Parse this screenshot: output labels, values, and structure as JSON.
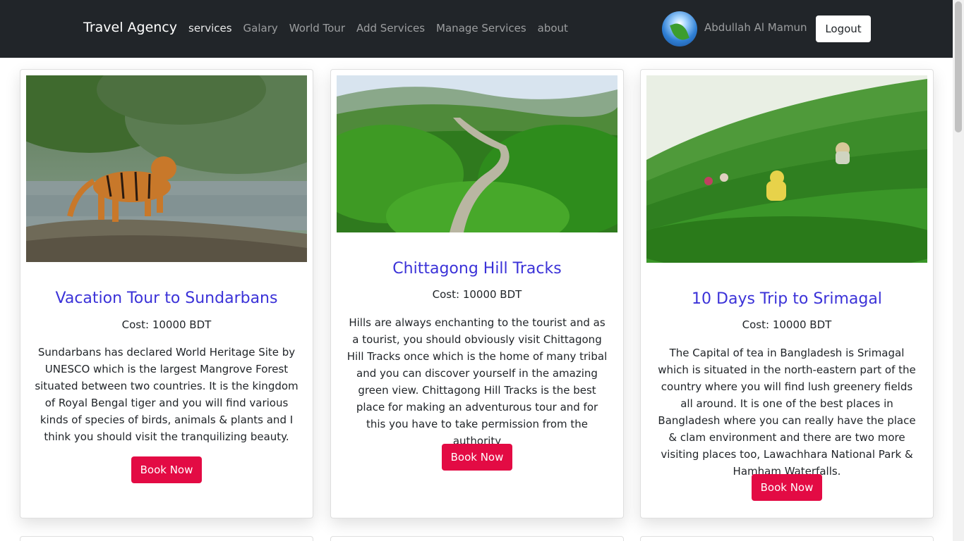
{
  "navbar": {
    "brand": "Travel Agency",
    "links": [
      "services",
      "Galary",
      "World Tour",
      "Add Services",
      "Manage Services",
      "about"
    ],
    "user_name": "Abdullah Al Mamun",
    "logout_label": "Logout"
  },
  "cards": [
    {
      "title": "Vacation Tour to Sundarbans",
      "cost": "Cost: 10000 BDT",
      "description": "Sundarbans has declared World Heritage Site by UNESCO which is the largest Mangrove Forest situated between two countries. It is the kingdom of Royal Bengal tiger and you will find various kinds of species of birds, animals & plants and I think you should visit the tranquilizing beauty.",
      "button": "Book Now"
    },
    {
      "title": "Chittagong Hill Tracks",
      "cost": "Cost: 10000 BDT",
      "description": "Hills are always enchanting to the tourist and as a tourist, you should obviously visit Chittagong Hill Tracks once which is the home of many tribal and you can discover yourself in the amazing green view. Chittagong Hill Tracks is the best place for making an adventurous tour and for this you have to take permission from the authority",
      "button": "Book Now"
    },
    {
      "title": "10 Days Trip to Srimagal",
      "cost": "Cost: 10000 BDT",
      "description": "The Capital of tea in Bangladesh is Srimagal which is situated in the north-eastern part of the country where you will find lush greenery fields all around. It is one of the best places in Bangladesh where you can really have the place & clam environment and there are two more visiting places too, Lawachhara National Park & Hamham Waterfalls.",
      "button": "Book Now"
    }
  ],
  "colors": {
    "navbar_bg": "#212529",
    "title": "#3b32d8",
    "book_button": "#e30b44"
  }
}
